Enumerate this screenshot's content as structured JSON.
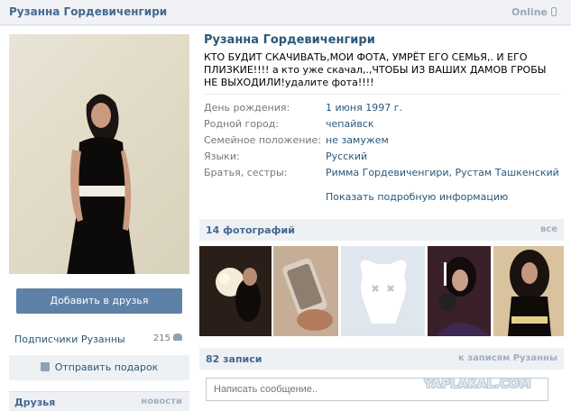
{
  "header": {
    "name": "Рузанна Гордевиченгири",
    "online": "Online"
  },
  "profile": {
    "name": "Рузанна Гордевиченгири",
    "status": "КТО БУДИТ СКАЧИВАТЬ,МОИ ФОТА, УМРЁТ ЕГО СЕМЬЯ,. И ЕГО ПЛИЗКИЕ!!!! а кто уже скачал,.,ЧТОБЫ ИЗ ВАШИХ ДАМОВ ГРОБЫ НЕ ВЫХОДИЛИ!удалите фота!!!!",
    "info": [
      {
        "key": "День рождения:",
        "value": "1 июня 1997 г."
      },
      {
        "key": "Родной город:",
        "value": "чепайвск"
      },
      {
        "key": "Семейное положение:",
        "value": "не замужем"
      },
      {
        "key": "Языки:",
        "value": "Русский"
      },
      {
        "key": "Братья, сестры:",
        "value": "Римма Гордевиченгири, Рустам Ташкенский"
      }
    ],
    "more_link": "Показать подробную информацию"
  },
  "left": {
    "add_friend": "Добавить в друзья",
    "followers_label": "Подписчики Рузанны",
    "followers_count": "215",
    "gift": "Отправить подарок",
    "friends_title": "Друзья",
    "friends_news": "новости"
  },
  "photos": {
    "title": "14 фотографий",
    "all": "все"
  },
  "posts": {
    "title": "82 записи",
    "link": "к записям Рузанны",
    "placeholder": "Написать сообщение.."
  },
  "watermark": "YAPLAKAL.COM",
  "colors": {
    "accent": "#45688e",
    "link": "#2b587a",
    "button": "#5e81a8",
    "muted": "#a1afc0"
  },
  "icons": [
    "phone-icon",
    "followers-icon",
    "gift-icon",
    "vk-dog-placeholder-icon"
  ]
}
